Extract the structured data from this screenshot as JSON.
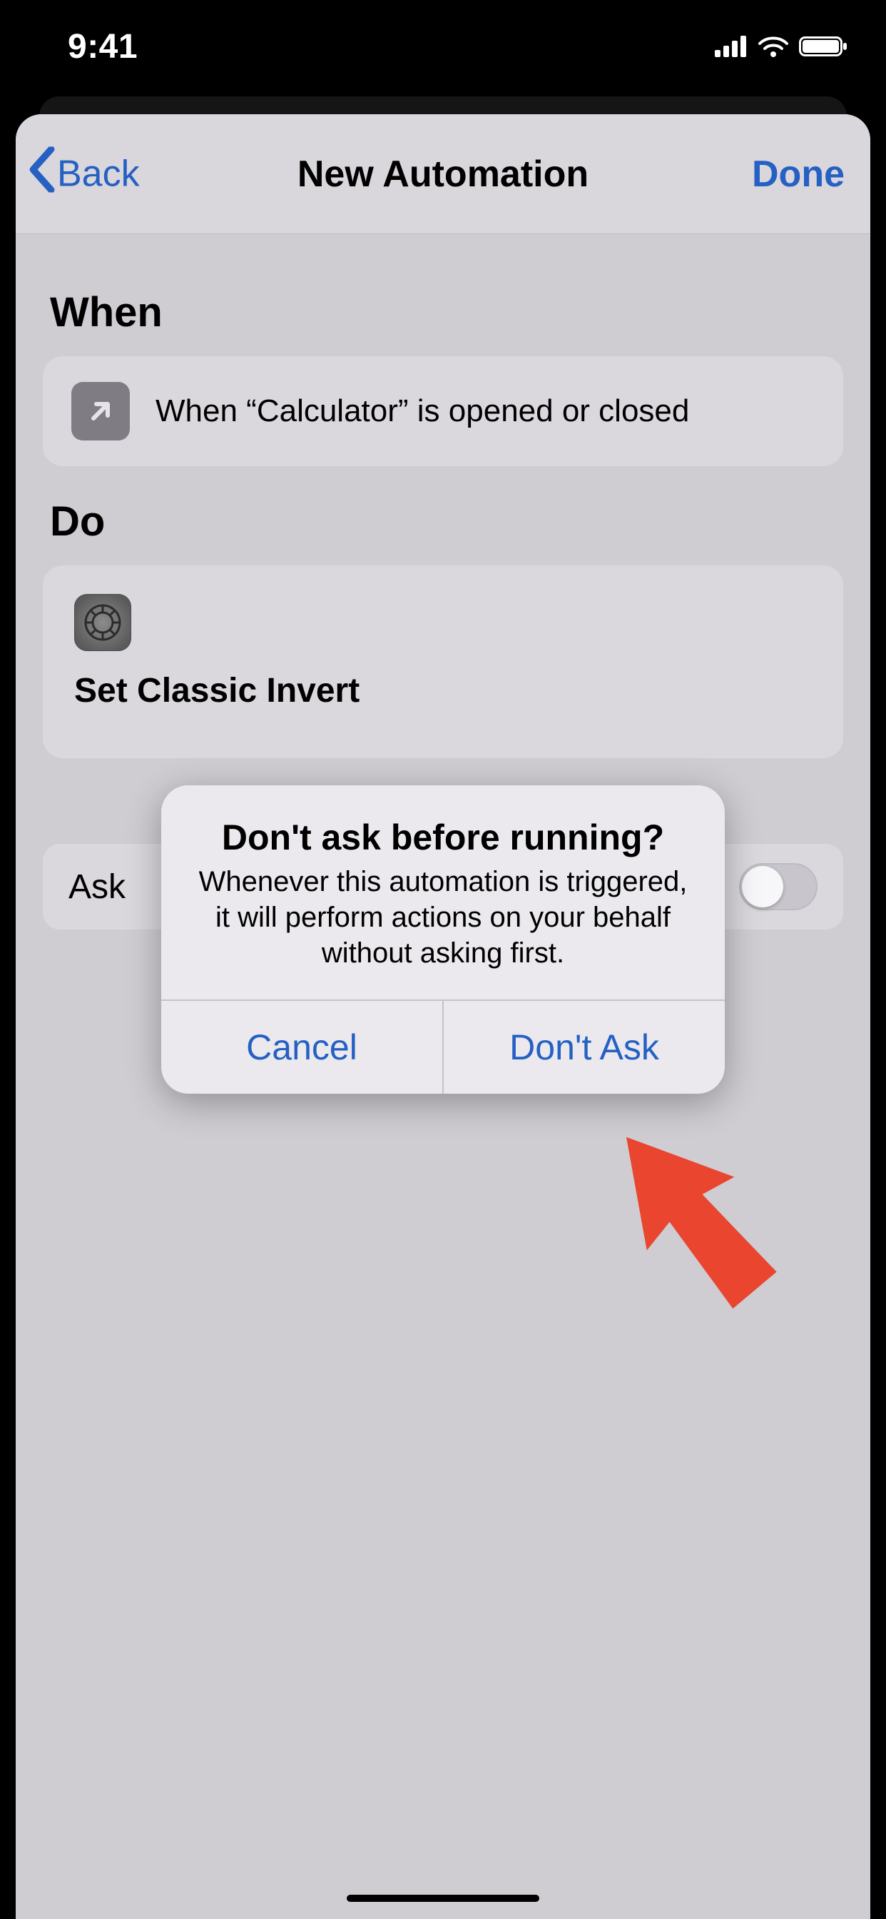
{
  "statusbar": {
    "time": "9:41"
  },
  "nav": {
    "back_label": "Back",
    "title": "New Automation",
    "done_label": "Done"
  },
  "sections": {
    "when_header": "When",
    "when_text": "When “Calculator” is opened or closed",
    "do_header": "Do",
    "do_action": "Set Classic Invert",
    "ask_label": "Ask"
  },
  "alert": {
    "title": "Don't ask before running?",
    "message": "Whenever this automation is triggered, it will perform actions on your behalf without asking first.",
    "cancel": "Cancel",
    "confirm": "Don't Ask"
  }
}
